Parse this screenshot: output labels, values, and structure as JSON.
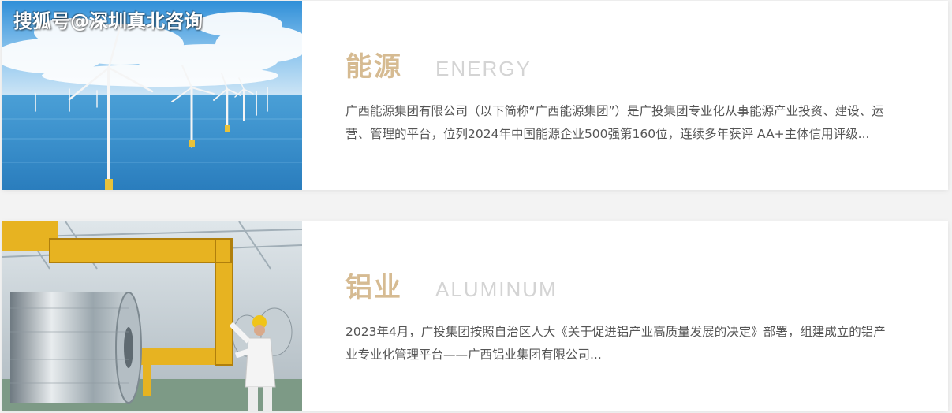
{
  "watermark": "搜狐号@深圳真北咨询",
  "sections": [
    {
      "title_cn": "能源",
      "title_en": "ENERGY",
      "description": "广西能源集团有限公司（以下简称“广西能源集团”）是广投集团专业化从事能源产业投资、建设、运营、管理的平台，位列2024年中国能源企业500强第160位，连续多年获评 AA+主体信用评级..."
    },
    {
      "title_cn": "铝业",
      "title_en": "ALUMINUM",
      "description": "2023年4月，广投集团按照自治区人大《关于促进铝产业高质量发展的决定》部署，组建成立的铝产业专业化管理平台——广西铝业集团有限公司..."
    }
  ],
  "colors": {
    "accent_gold": "#d6bb92",
    "english_title": "#d4d4d4",
    "body_text": "#555555"
  }
}
